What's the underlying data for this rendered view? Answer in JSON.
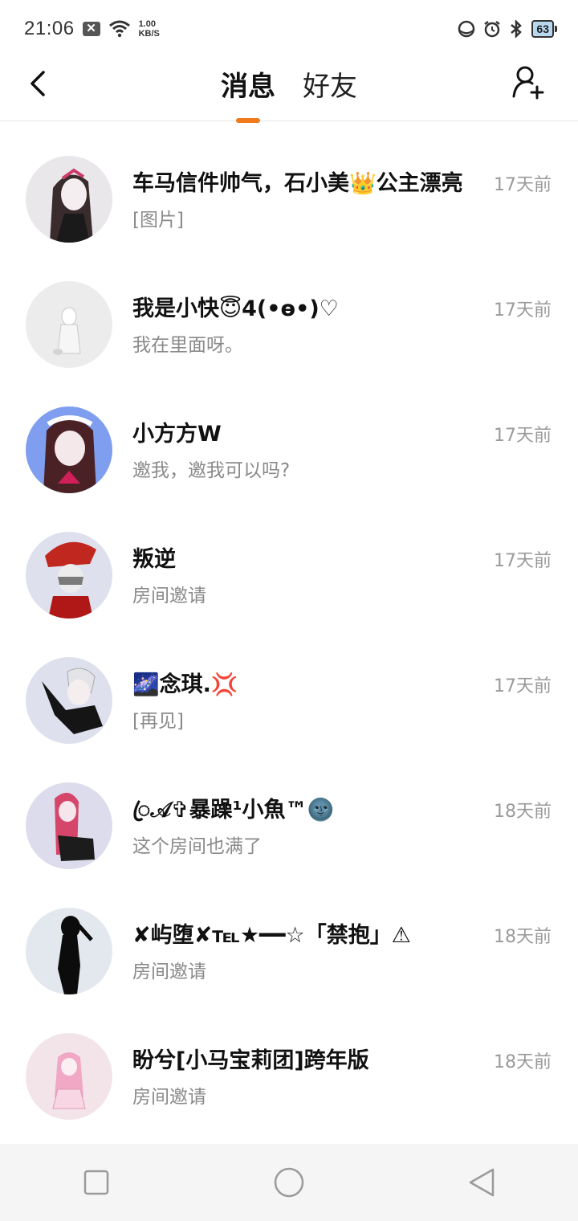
{
  "status_bar": {
    "time": "21:06",
    "net_speed_value": "1.00",
    "net_speed_unit": "KB/S",
    "battery": "63"
  },
  "header": {
    "tabs": [
      {
        "label": "消息",
        "active": true
      },
      {
        "label": "好友",
        "active": false
      }
    ]
  },
  "colors": {
    "accent": "#f07a1c",
    "name_text": "#111111",
    "secondary_text": "#8a8a8a"
  },
  "messages": [
    {
      "name": "车马信件帅气，石小美👑公主漂亮",
      "preview": "[图片]",
      "time": "17天前",
      "avatar_bg": "#e9e7ea"
    },
    {
      "name": "我是小快😇4(•ɵ•)♡",
      "preview": "我在里面呀。",
      "time": "17天前",
      "avatar_bg": "#ececec"
    },
    {
      "name": "小方方W",
      "preview": "邀我，邀我可以吗?",
      "time": "17天前",
      "avatar_bg": "#7f9ef0"
    },
    {
      "name": "叛逆",
      "preview": "房间邀请",
      "time": "17天前",
      "avatar_bg": "#dfe0ee"
    },
    {
      "name": "🌌念琪.💢",
      "preview": "[再见]",
      "time": "17天前",
      "avatar_bg": "#dfe0ee"
    },
    {
      "name": "ꦿ𝒜✞暴躁¹小魚™🌚",
      "preview": "这个房间也满了",
      "time": "18天前",
      "avatar_bg": "#dcdcec"
    },
    {
      "name": "✘屿堕✘℡★━━☆「禁抱」⚠",
      "preview": "房间邀请",
      "time": "18天前",
      "avatar_bg": "#e3e8ef"
    },
    {
      "name": "盼兮[小马宝莉团]跨年版",
      "preview": "房间邀请",
      "time": "18天前",
      "avatar_bg": "#f3e4ea"
    }
  ]
}
